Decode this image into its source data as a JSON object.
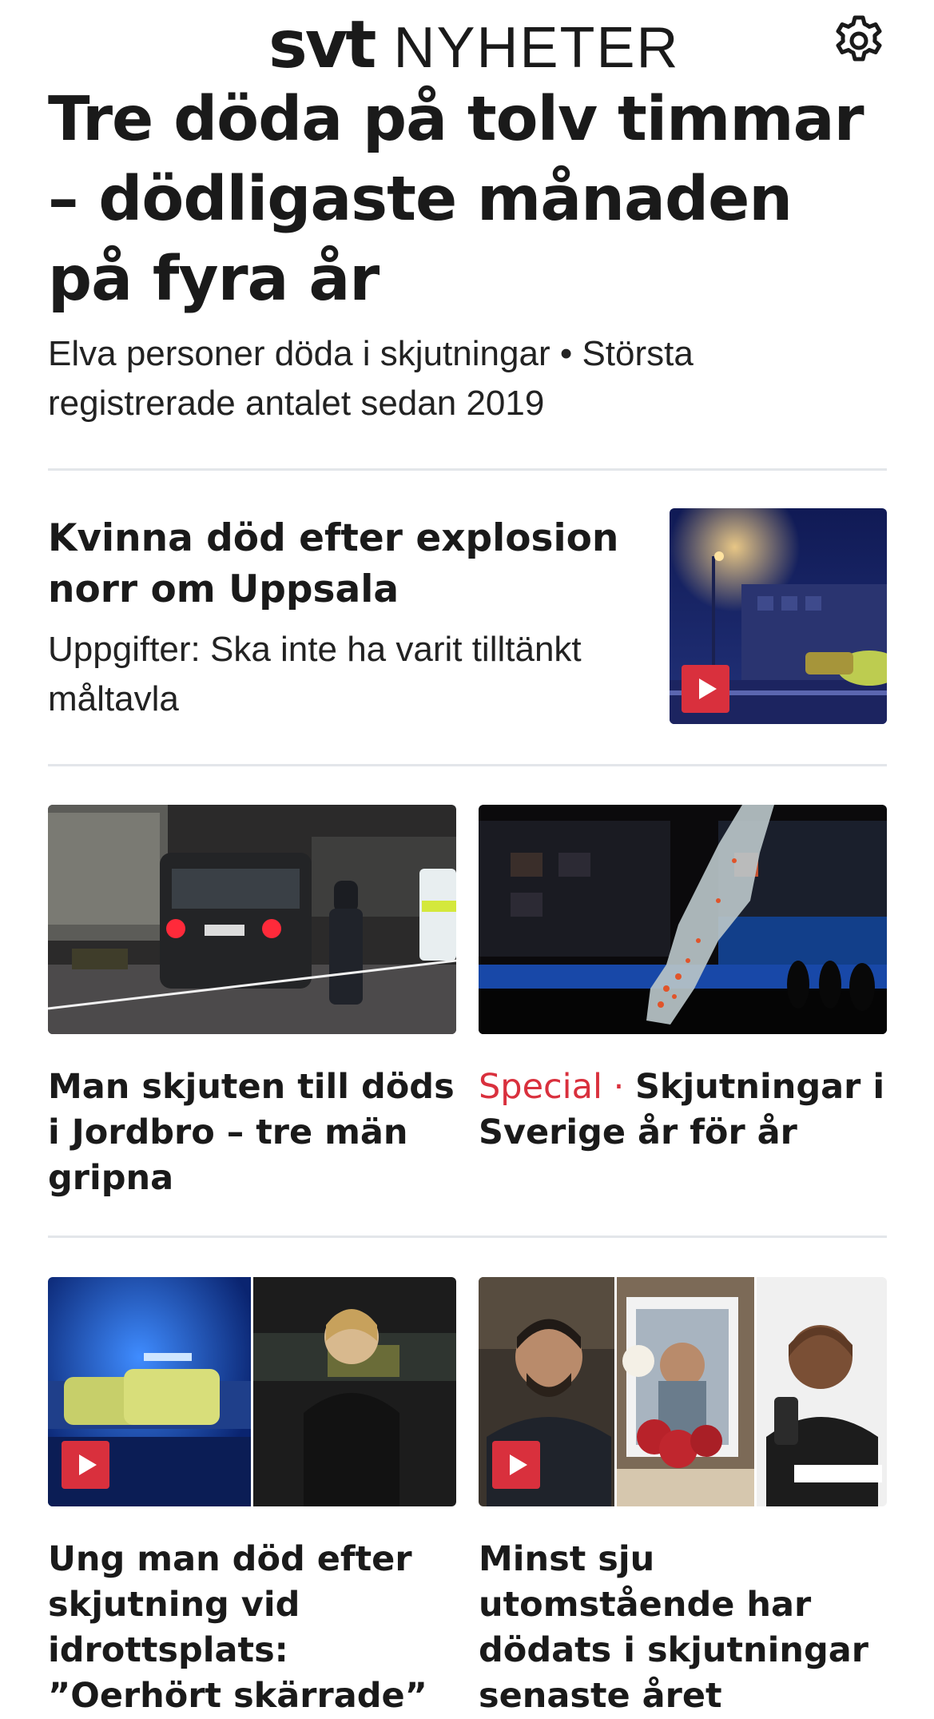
{
  "header": {
    "logo_primary": "svt",
    "logo_secondary": "NYHETER",
    "settings_icon": "gear-icon"
  },
  "lead": {
    "title": "Tre döda på tolv timmar – dödligaste månaden på fyra år",
    "subtitle": "Elva personer döda i skjutningar • Största registrerade antalet sedan 2019"
  },
  "story2": {
    "title": "Kvinna död efter explosion norr om Uppsala",
    "subtitle": "Uppgifter: Ska inte ha varit tilltänkt måltavla",
    "has_video": true
  },
  "grid1": [
    {
      "title": "Man skjuten till döds i Jordbro – tre män gripna",
      "label": ""
    },
    {
      "label": "Special",
      "separator": " · ",
      "title": "Skjutningar i Sverige år för år"
    }
  ],
  "grid2": [
    {
      "title": "Ung man död efter skjutning vid idrottsplats: ”Oerhört skärrade”",
      "has_video": true
    },
    {
      "title": "Minst sju utomstående har dödats i skjutningar senaste året",
      "has_video": true
    }
  ],
  "colors": {
    "accent_red": "#d9303d",
    "text": "#1a1a1a",
    "divider": "#e3e6ea"
  }
}
